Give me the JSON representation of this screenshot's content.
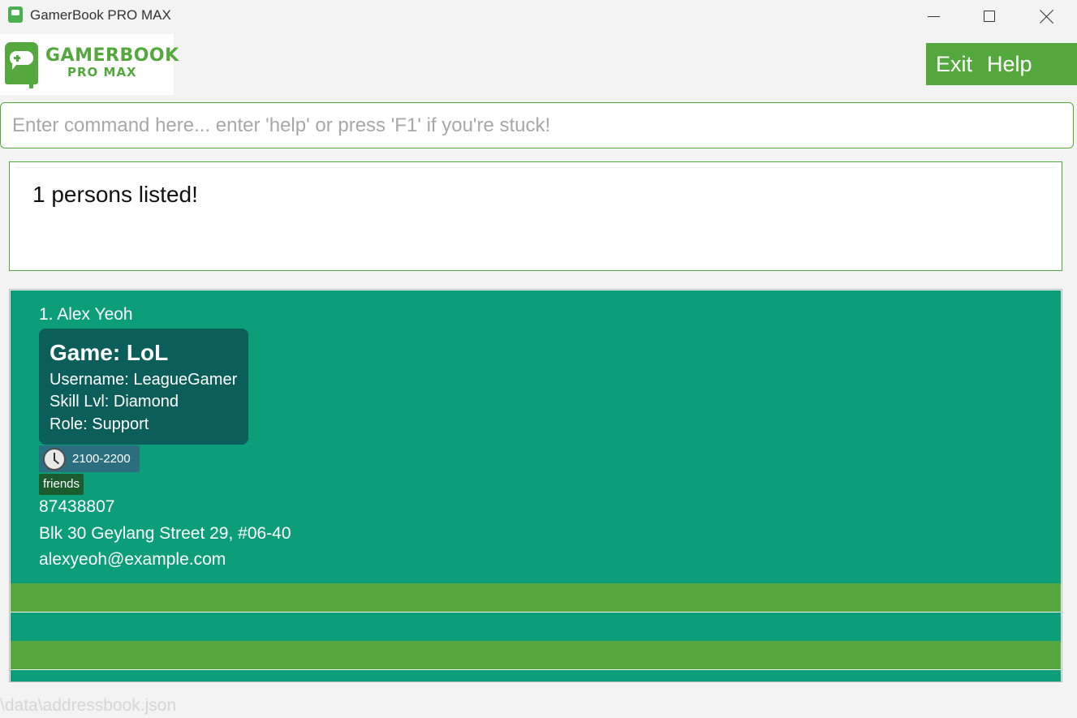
{
  "window": {
    "title": "GamerBook PRO MAX"
  },
  "logo": {
    "line1": "GAMERBOOK",
    "line2": "PRO MAX"
  },
  "menu": {
    "exit_label": "Exit",
    "help_label": "Help"
  },
  "command": {
    "value": "",
    "placeholder": "Enter command here... enter 'help' or press 'F1' if you're stuck!"
  },
  "result": {
    "message": "1 persons listed!"
  },
  "persons": [
    {
      "index_name": "1. Alex Yeoh",
      "game": {
        "title": "Game: LoL",
        "username": "Username: LeagueGamer",
        "skill": "Skill Lvl: Diamond",
        "role": "Role: Support"
      },
      "time_slot": "2100-2200",
      "tags": [
        "friends"
      ],
      "phone": "87438807",
      "address": "Blk 30 Geylang Street 29, #06-40",
      "email": "alexyeoh@example.com"
    }
  ],
  "status_bar": {
    "path": "\\data\\addressbook.json"
  },
  "colors": {
    "accent_green": "#55a83d",
    "card_teal": "#0b9e78",
    "game_box": "#0b5e5a",
    "time_badge": "#2b6f7f",
    "tag_badge": "#1b5c2e"
  },
  "icons": {
    "app": "gamerbook-app-icon",
    "time": "clock-icon"
  }
}
